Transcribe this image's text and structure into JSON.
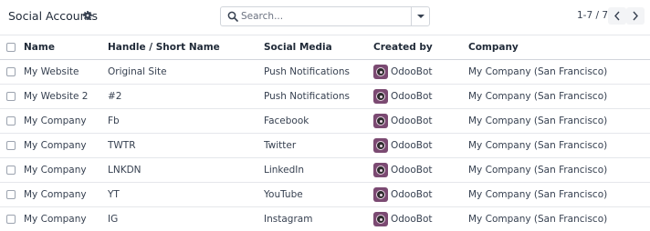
{
  "header": {
    "title": "Social Accounts",
    "gear_icon": "gear-icon"
  },
  "search": {
    "placeholder": "Search...",
    "value": ""
  },
  "pager": {
    "range": "1-7 / 7"
  },
  "table": {
    "columns": [
      "Name",
      "Handle / Short Name",
      "Social Media",
      "Created by",
      "Company"
    ],
    "rows": [
      {
        "name": "My Website",
        "handle": "Original Site",
        "media": "Push Notifications",
        "created_by": "OdooBot",
        "company": "My Company (San Francisco)"
      },
      {
        "name": "My Website 2",
        "handle": "#2",
        "media": "Push Notifications",
        "created_by": "OdooBot",
        "company": "My Company (San Francisco)"
      },
      {
        "name": "My Company",
        "handle": "Fb",
        "media": "Facebook",
        "created_by": "OdooBot",
        "company": "My Company (San Francisco)"
      },
      {
        "name": "My Company",
        "handle": "TWTR",
        "media": "Twitter",
        "created_by": "OdooBot",
        "company": "My Company (San Francisco)"
      },
      {
        "name": "My Company",
        "handle": "LNKDN",
        "media": "LinkedIn",
        "created_by": "OdooBot",
        "company": "My Company (San Francisco)"
      },
      {
        "name": "My Company",
        "handle": "YT",
        "media": "YouTube",
        "created_by": "OdooBot",
        "company": "My Company (San Francisco)"
      },
      {
        "name": "My Company",
        "handle": "IG",
        "media": "Instagram",
        "created_by": "OdooBot",
        "company": "My Company (San Francisco)"
      }
    ]
  },
  "colors": {
    "avatar": "#7b4a72",
    "border": "#e5e7eb",
    "text": "#374151"
  }
}
